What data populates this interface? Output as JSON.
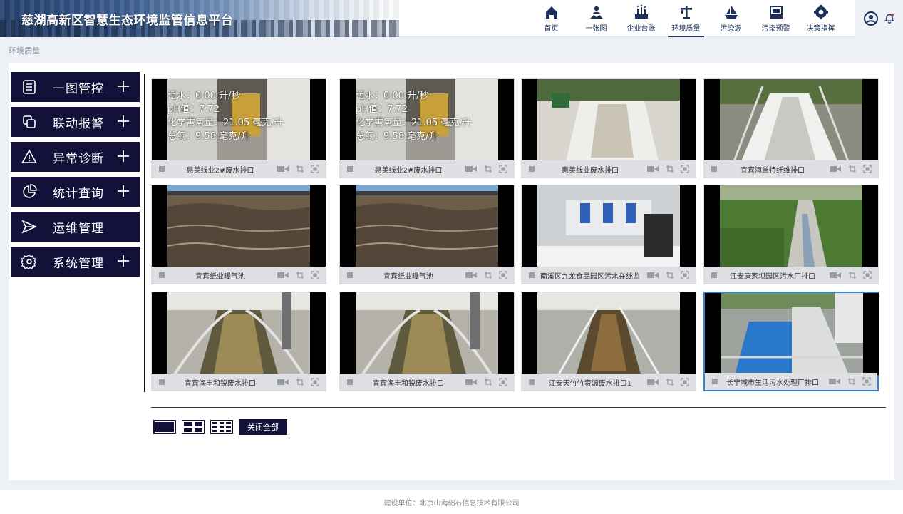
{
  "header": {
    "title": "慈湖高新区智慧生态环境监管信息平台",
    "nav": [
      {
        "label": "首页",
        "icon": "home-icon"
      },
      {
        "label": "一张图",
        "icon": "map-person-icon"
      },
      {
        "label": "企业台账",
        "icon": "factory-icon"
      },
      {
        "label": "环境质量",
        "icon": "crane-icon",
        "active": true
      },
      {
        "label": "污染源",
        "icon": "ship-icon"
      },
      {
        "label": "污染预警",
        "icon": "warning-board-icon"
      },
      {
        "label": "决策指挥",
        "icon": "gear-badge-icon"
      }
    ]
  },
  "breadcrumb": "环境质量",
  "sidebar": {
    "items": [
      {
        "label": "一图管控",
        "icon": "list-icon",
        "expandable": true
      },
      {
        "label": "联动报警",
        "icon": "copy-icon",
        "expandable": true
      },
      {
        "label": "异常诊断",
        "icon": "alert-triangle-icon",
        "expandable": true
      },
      {
        "label": "统计查询",
        "icon": "pie-chart-icon",
        "expandable": true
      },
      {
        "label": "运维管理",
        "icon": "send-icon",
        "expandable": false
      },
      {
        "label": "系统管理",
        "icon": "settings-icon",
        "expandable": true
      }
    ]
  },
  "cameras": [
    {
      "name": "惠美线业2#废水排口",
      "overlay": [
        "污水：0.00 升/秒",
        "pH值：7.72",
        "化学需氧量：21.05 毫克/升",
        "总氮：9.58 毫克/升"
      ],
      "scene": "pipe"
    },
    {
      "name": "惠美线业2#废水排口",
      "overlay": [
        "污水：0.00 升/秒",
        "pH值：7.72",
        "化学需氧量：21.05 毫克/升",
        "总氮：9.58 毫克/升"
      ],
      "scene": "pipe"
    },
    {
      "name": "惠美线业废水排口",
      "overlay": [],
      "scene": "channel"
    },
    {
      "name": "宜宾海丝特纤维排口",
      "overlay": [],
      "scene": "flume"
    },
    {
      "name": "宜宾纸业曝气池",
      "overlay": [],
      "scene": "pool"
    },
    {
      "name": "宜宾纸业曝气池",
      "overlay": [],
      "scene": "pool"
    },
    {
      "name": "南溪区九龙食品园区污水在线监",
      "overlay": [],
      "scene": "room"
    },
    {
      "name": "江安康家坝园区污水厂排口",
      "overlay": [],
      "scene": "grass"
    },
    {
      "name": "宜宾海丰和锐废水排口",
      "overlay": [],
      "scene": "rail"
    },
    {
      "name": "宜宾海丰和锐废水排口",
      "overlay": [],
      "scene": "rail"
    },
    {
      "name": "江安天竹竹资源废水排口1",
      "overlay": [],
      "scene": "ditch"
    },
    {
      "name": "长宁城市生活污水处理厂排口",
      "overlay": [],
      "scene": "blue",
      "selected": true
    }
  ],
  "toolbar": {
    "close_all_label": "关闭全部"
  },
  "footer": "建设单位：北京山海础石信息技术有限公司"
}
